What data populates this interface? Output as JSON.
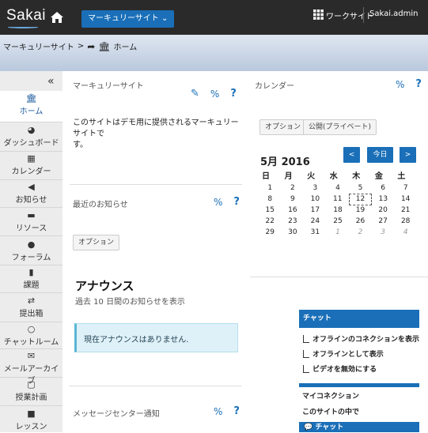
{
  "topbar": {
    "logo": "Sakai",
    "site_button": "マーキュリーサイト ⌄",
    "worksite": "ワークサイト",
    "user": "Sakai.admin"
  },
  "breadcrumb": {
    "site": "マーキュリーサイト",
    "separator": ">",
    "page": "ホーム"
  },
  "sidebar": {
    "collapse": "«",
    "items": [
      {
        "label": "ホーム",
        "icon": "home-icon"
      },
      {
        "label": "ダッシュボード",
        "icon": "dashboard-icon"
      },
      {
        "label": "カレンダー",
        "icon": "calendar-icon"
      },
      {
        "label": "お知らせ",
        "icon": "megaphone-icon"
      },
      {
        "label": "リソース",
        "icon": "folder-icon"
      },
      {
        "label": "フォーラム",
        "icon": "comments-icon"
      },
      {
        "label": "課題",
        "icon": "file-icon"
      },
      {
        "label": "提出箱",
        "icon": "exchange-icon"
      },
      {
        "label": "チャットルーム",
        "icon": "chat-icon"
      },
      {
        "label": "メールアーカイブ",
        "icon": "mail-icon"
      },
      {
        "label": "授業計画",
        "icon": "book-icon"
      },
      {
        "label": "レッスン",
        "icon": "lesson-icon"
      }
    ]
  },
  "site_info": {
    "title": "マーキュリーサイト",
    "text_line1": "このサイトはデモ用に提供されるマーキュリーサイトで",
    "text_line2": "す。"
  },
  "calendar": {
    "title": "カレンダー",
    "options": "オプション",
    "public": "公開(プライベート)",
    "month": "5月 2016",
    "prev": "<",
    "today": "今日",
    "next": ">",
    "weekdays": [
      "日",
      "月",
      "火",
      "水",
      "木",
      "金",
      "土"
    ],
    "weeks": [
      [
        "1",
        "2",
        "3",
        "4",
        "5",
        "6",
        "7"
      ],
      [
        "8",
        "9",
        "10",
        "11",
        "12",
        "13",
        "14"
      ],
      [
        "15",
        "16",
        "17",
        "18",
        "19",
        "20",
        "21"
      ],
      [
        "22",
        "23",
        "24",
        "25",
        "26",
        "27",
        "28"
      ],
      [
        "29",
        "30",
        "31",
        "1",
        "2",
        "3",
        "4"
      ]
    ],
    "today_date": "12"
  },
  "announcements": {
    "title": "最近のお知らせ",
    "options": "オプション",
    "heading": "アナウンス",
    "subheading": "過去 10 日間のお知らせを表示",
    "empty": "現在アナウンスはありません."
  },
  "messages": {
    "title": "メッセージセンター通知"
  },
  "chat": {
    "header": "チャット",
    "options": [
      "オフラインのコネクションを表示",
      "オフラインとして表示",
      "ビデオを無効にする"
    ],
    "my_connections": "マイコネクション",
    "in_site": "このサイトの中で",
    "footer": "チャット"
  },
  "colors": {
    "accent": "#1a6fb8",
    "topbar": "#2a2a2a",
    "info_box": "#dff1f8"
  }
}
